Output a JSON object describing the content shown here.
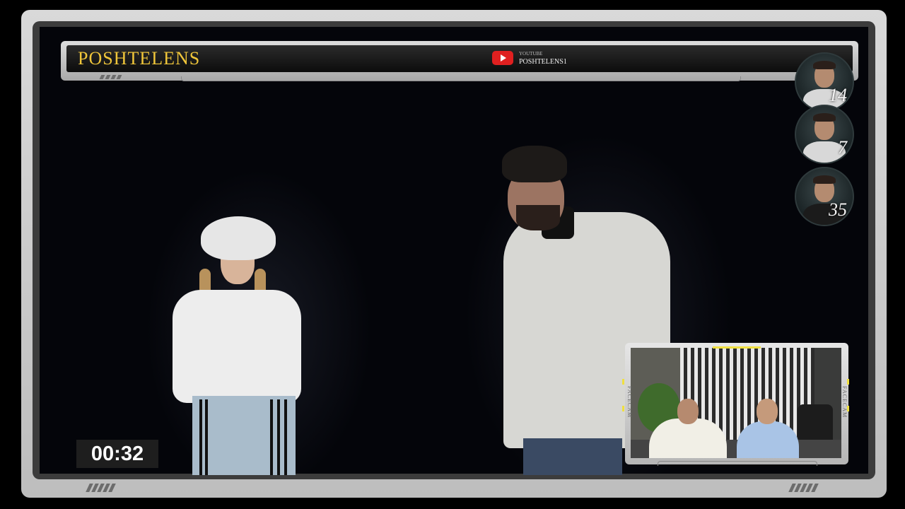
{
  "header": {
    "brand": "POSHTELENS",
    "youtube_small": "YOUTUBE",
    "youtube_handle": "POSHTELENS1"
  },
  "scores": [
    {
      "value": "14"
    },
    {
      "value": "7"
    },
    {
      "value": "35"
    }
  ],
  "timer": {
    "value": "00:32"
  },
  "facecam": {
    "label_left": "FACECAM",
    "label_right": "FACECAM"
  },
  "colors": {
    "brand": "#f0c63a",
    "youtube_red": "#e02020",
    "accent_yellow": "#f0e040"
  },
  "icons": {
    "youtube": "youtube-play-icon"
  }
}
